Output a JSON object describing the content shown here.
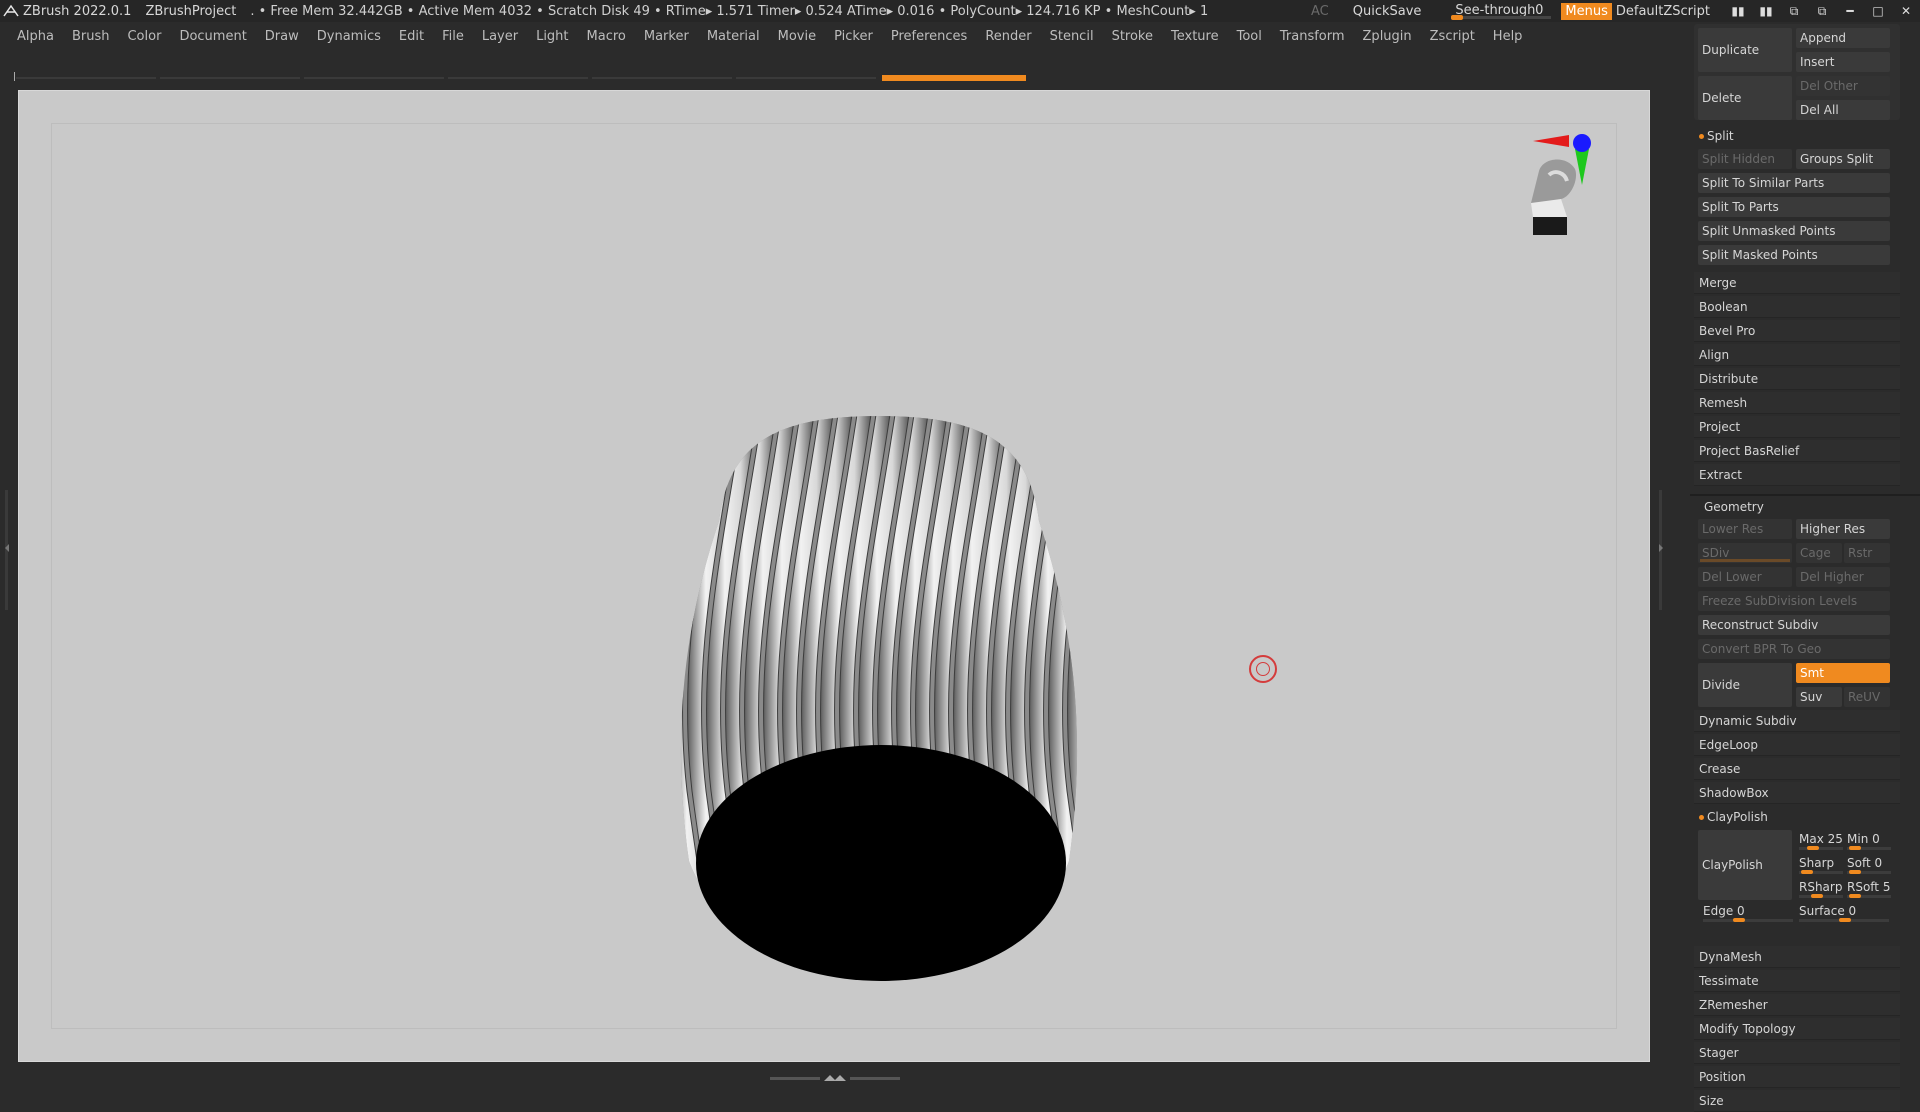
{
  "titlebar": {
    "app_title": "ZBrush 2022.0.1",
    "project": "ZBrushProject",
    "stats": ". • Free Mem 32.442GB • Active Mem 4032 • Scratch Disk 49 •  RTime▸ 1.571 Timer▸ 0.524 ATime▸ 0.016 • PolyCount▸ 124.716 KP  • MeshCount▸ 1",
    "ac": "AC",
    "quicksave": "QuickSave",
    "seethrough_label": "See-through",
    "seethrough_value": "0",
    "seethrough_fraction": 0,
    "menus": "Menus",
    "default_zscript": "DefaultZScript"
  },
  "menubar": {
    "items": [
      "Alpha",
      "Brush",
      "Color",
      "Document",
      "Draw",
      "Dynamics",
      "Edit",
      "File",
      "Layer",
      "Light",
      "Macro",
      "Marker",
      "Material",
      "Movie",
      "Picker",
      "Preferences",
      "Render",
      "Stencil",
      "Stroke",
      "Texture",
      "Tool",
      "Transform",
      "Zplugin",
      "Zscript",
      "Help"
    ]
  },
  "subtool": {
    "duplicate": "Duplicate",
    "append": "Append",
    "insert": "Insert",
    "delete": "Delete",
    "del_other": "Del Other",
    "del_all": "Del All",
    "split_header": "Split",
    "split_hidden": "Split Hidden",
    "groups_split": "Groups Split",
    "split_similar": "Split To Similar Parts",
    "split_parts": "Split To Parts",
    "split_unmasked": "Split Unmasked Points",
    "split_masked": "Split Masked Points",
    "list": [
      "Merge",
      "Boolean",
      "Bevel Pro",
      "Align",
      "Distribute",
      "Remesh",
      "Project",
      "Project BasRelief",
      "Extract"
    ]
  },
  "geometry": {
    "header": "Geometry",
    "lower_res": "Lower Res",
    "higher_res": "Higher Res",
    "sdiv": "SDiv",
    "cage": "Cage",
    "rstr": "Rstr",
    "del_lower": "Del Lower",
    "del_higher": "Del Higher",
    "freeze": "Freeze SubDivision Levels",
    "reconstruct": "Reconstruct Subdiv",
    "convert_bpr": "Convert BPR To Geo",
    "divide": "Divide",
    "smt": "Smt",
    "suv": "Suv",
    "reuv": "ReUV",
    "dynamic_subdiv": "Dynamic Subdiv",
    "edgeloop": "EdgeLoop",
    "crease": "Crease",
    "shadowbox": "ShadowBox",
    "claypolish_header": "ClayPolish",
    "claypolish_btn": "ClayPolish",
    "max": "Max 25",
    "min": "Min 0",
    "sharp": "Sharp",
    "soft": "Soft 0",
    "rsharp": "RSharp",
    "rsoft": "RSoft 5",
    "edge": "Edge 0",
    "surface": "Surface 0",
    "list2": [
      "DynaMesh",
      "Tessimate",
      "ZRemesher",
      "Modify Topology",
      "Stager",
      "Position",
      "Size"
    ]
  },
  "colors": {
    "accent": "#f08a1f",
    "canvas": "#c9c9c9",
    "bg": "#2b2b2b"
  }
}
